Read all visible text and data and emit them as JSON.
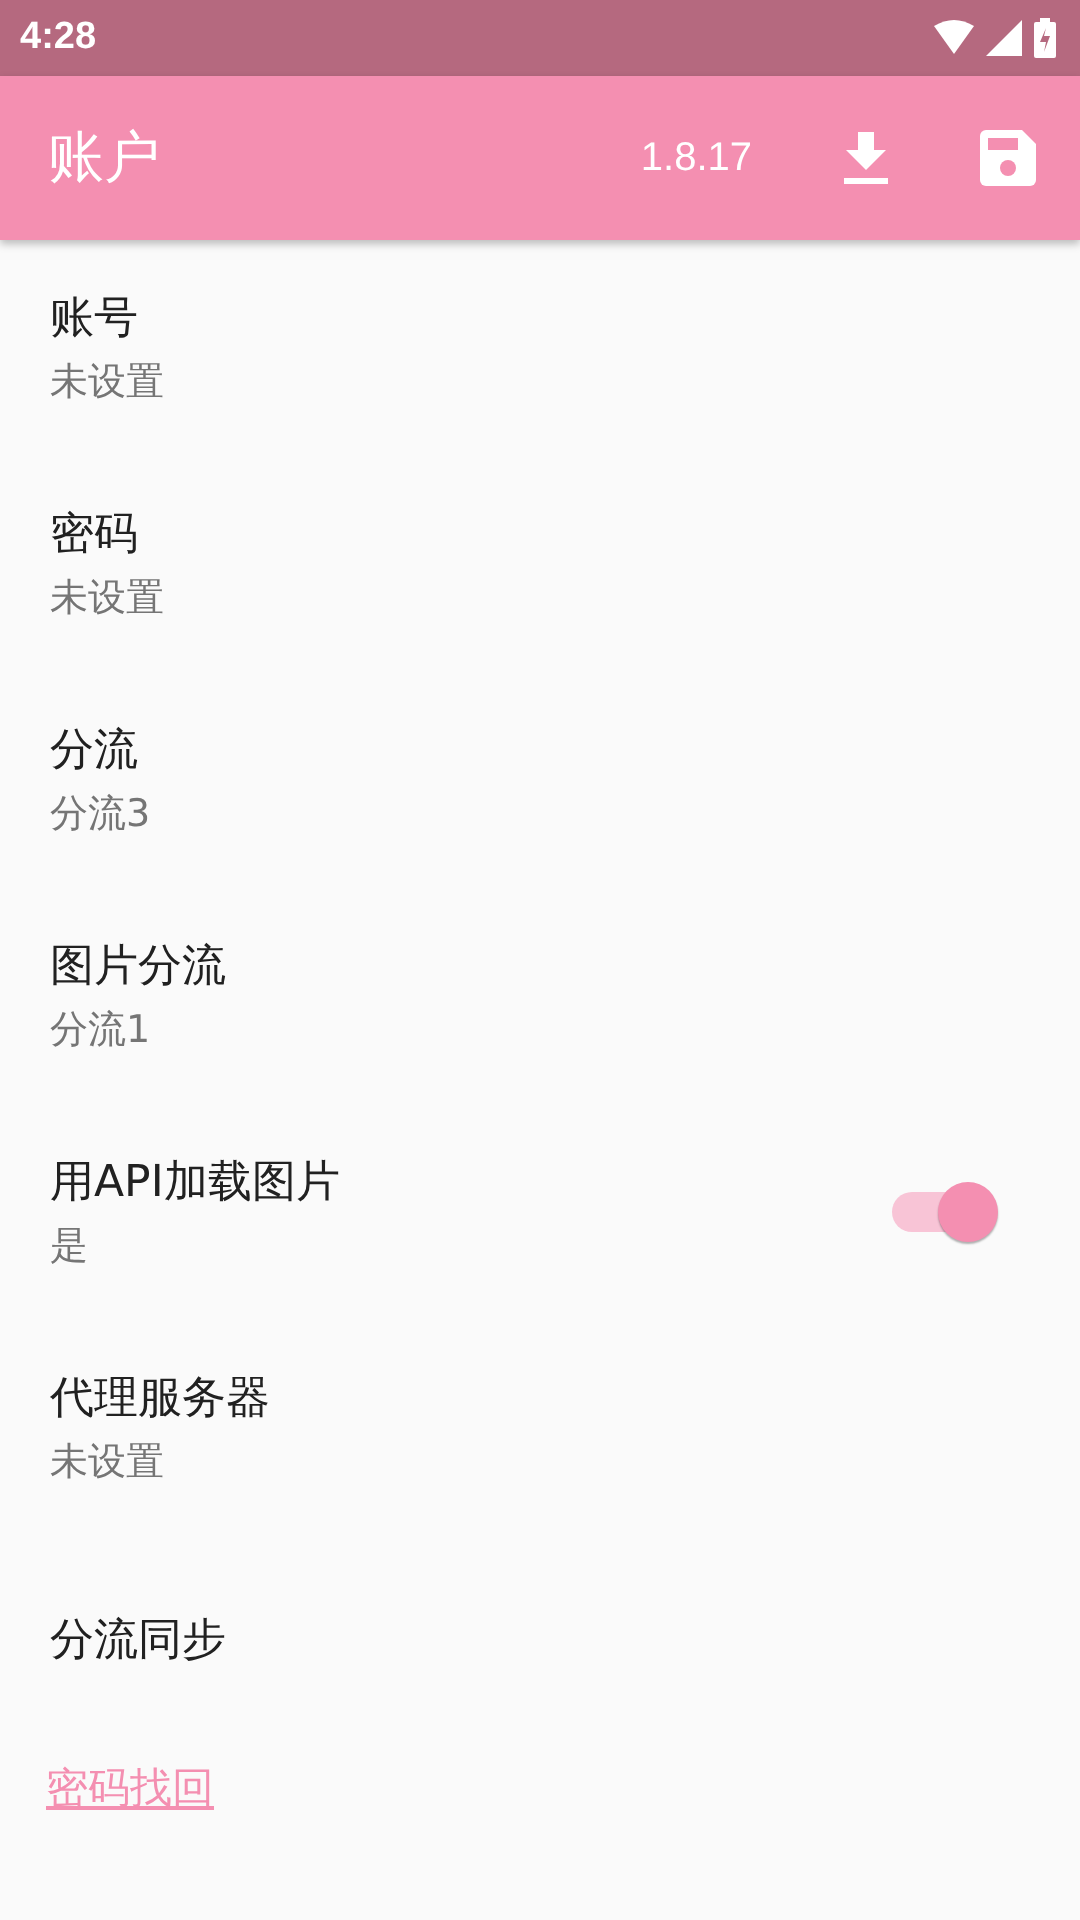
{
  "status_bar": {
    "time": "4:28"
  },
  "toolbar": {
    "title": "账户",
    "version": "1.8.17"
  },
  "settings": [
    {
      "kind": "text",
      "title": "账号",
      "summary": "未设置"
    },
    {
      "kind": "text",
      "title": "密码",
      "summary": "未设置"
    },
    {
      "kind": "text",
      "title": "分流",
      "summary": "分流3"
    },
    {
      "kind": "text",
      "title": "图片分流",
      "summary": "分流1"
    },
    {
      "kind": "switch",
      "title": "用API加载图片",
      "summary": "是",
      "on": true
    },
    {
      "kind": "text",
      "title": "代理服务器",
      "summary": "未设置"
    },
    {
      "kind": "plain",
      "title": "分流同步"
    }
  ],
  "link": "密码找回"
}
